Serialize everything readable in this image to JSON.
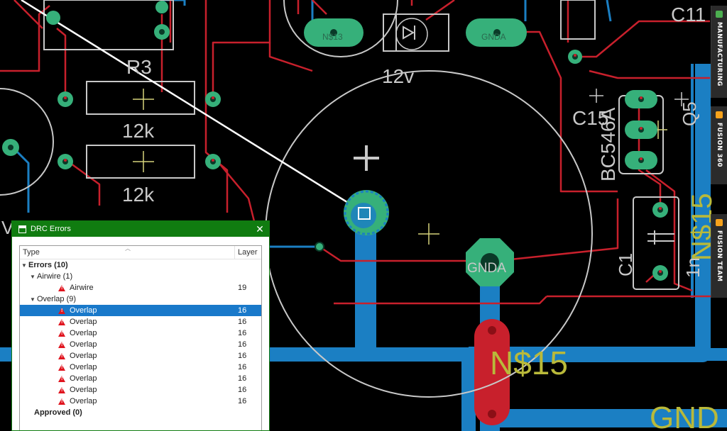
{
  "board": {
    "labels": {
      "r3": "R3",
      "r_top_value": "12k",
      "r_bottom_value": "12k",
      "diode_value": "12v",
      "c11": "C11",
      "c15": "C15",
      "q5": "Q5",
      "q5_value": "BC546A",
      "c1": "C1",
      "c1_value": "1n",
      "ns15_small": "N$15",
      "ns15_big": "N$15",
      "gnda_pad": "GNDA",
      "gnd_bottom": "GND",
      "ns13_pad": "N$13",
      "gnda_diode": "GNDA",
      "v_left": "V"
    },
    "colors": {
      "background": "#000000",
      "trace_top": "#c8202c",
      "trace_bottom": "#1b7fc3",
      "pad": "#36b07a",
      "silkscreen": "#c8c8c8",
      "ratsnest": "#ffffff",
      "origin": "#d6d37a"
    }
  },
  "side_tabs": [
    {
      "label": "MANUFACTURING",
      "icon": "manufacturing-icon",
      "color": "#4caf50"
    },
    {
      "label": "FUSION 360",
      "icon": "fusion-icon",
      "color": "#f7a21b"
    },
    {
      "label": "FUSION TEAM",
      "icon": "fusion-team-icon",
      "color": "#f7a21b"
    }
  ],
  "drc": {
    "title": "DRC Errors",
    "columns": {
      "type": "Type",
      "layer": "Layer"
    },
    "errors_group": "Errors (10)",
    "airwire_group": "Airwire (1)",
    "airwire_items": [
      {
        "label": "Airwire",
        "layer": "19"
      }
    ],
    "overlap_group": "Overlap (9)",
    "overlap_items": [
      {
        "label": "Overlap",
        "layer": "16"
      },
      {
        "label": "Overlap",
        "layer": "16"
      },
      {
        "label": "Overlap",
        "layer": "16"
      },
      {
        "label": "Overlap",
        "layer": "16"
      },
      {
        "label": "Overlap",
        "layer": "16"
      },
      {
        "label": "Overlap",
        "layer": "16"
      },
      {
        "label": "Overlap",
        "layer": "16"
      },
      {
        "label": "Overlap",
        "layer": "16"
      },
      {
        "label": "Overlap",
        "layer": "16"
      }
    ],
    "approved_group": "Approved (0)"
  }
}
